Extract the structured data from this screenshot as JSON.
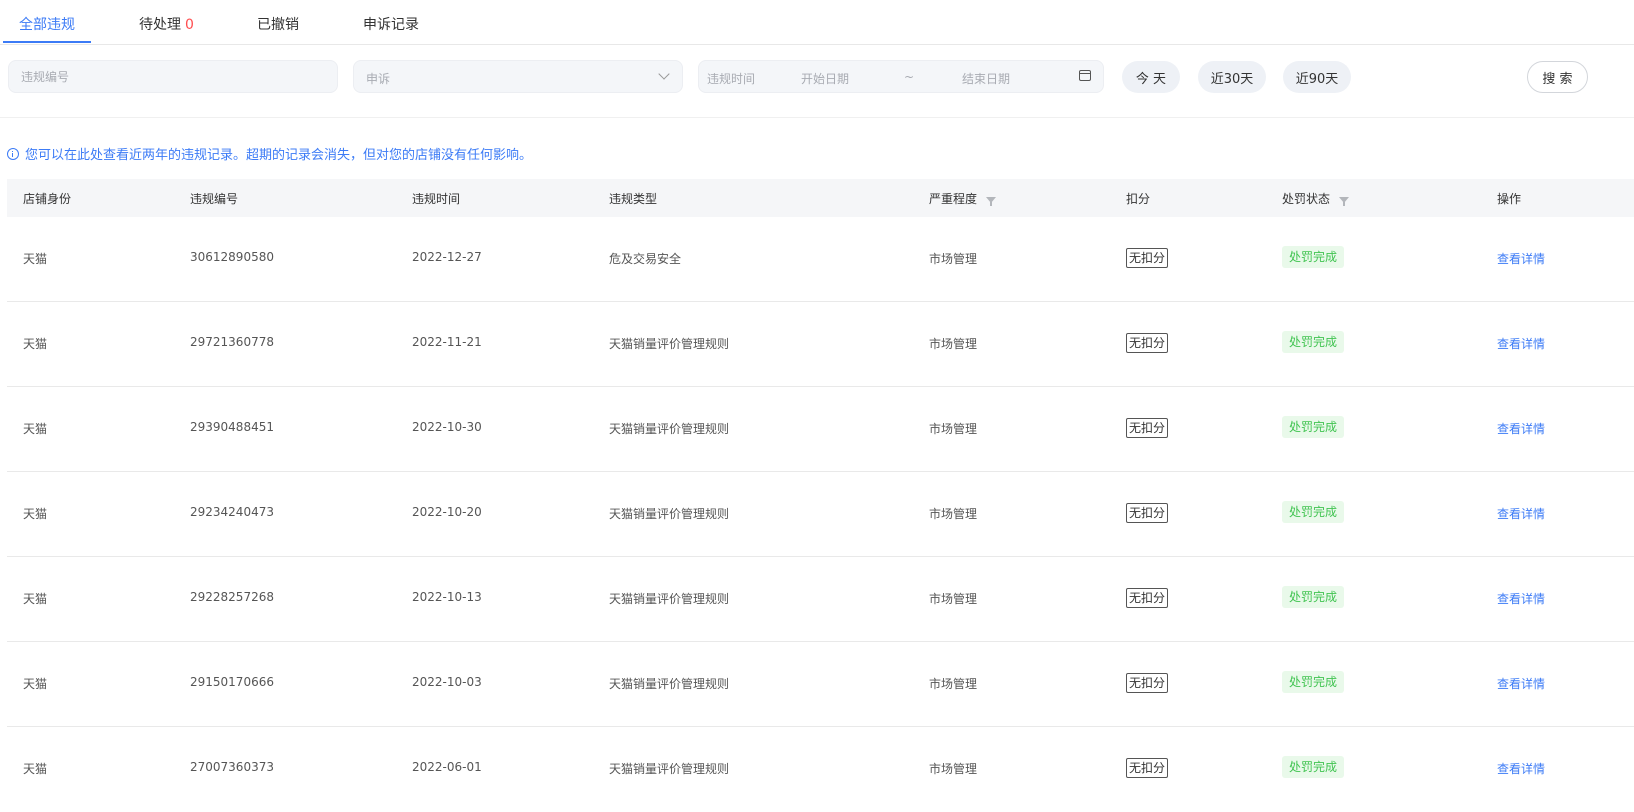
{
  "tabs": [
    {
      "label": "全部违规"
    },
    {
      "label": "待处理",
      "count": "0"
    },
    {
      "label": "已撤销"
    },
    {
      "label": "申诉记录"
    }
  ],
  "filters": {
    "violation_no_placeholder": "违规编号",
    "appeal_select_value": "申诉",
    "date_label": "违规时间",
    "start_placeholder": "开始日期",
    "range_sep": "~",
    "end_placeholder": "结束日期",
    "quick": [
      "今 天",
      "近30天",
      "近90天"
    ],
    "search_label": "搜 索"
  },
  "notice": "您可以在此处查看近两年的违规记录。超期的记录会消失，但对您的店铺没有任何影响。",
  "table": {
    "headers": [
      "店铺身份",
      "违规编号",
      "违规时间",
      "违规类型",
      "严重程度",
      "扣分",
      "处罚状态",
      "操作"
    ],
    "rows": [
      {
        "shop": "天猫",
        "id": "30612890580",
        "date": "2022-12-27",
        "type": "危及交易安全",
        "severity": "市场管理",
        "score": "无扣分",
        "status": "处罚完成",
        "action": "查看详情"
      },
      {
        "shop": "天猫",
        "id": "29721360778",
        "date": "2022-11-21",
        "type": "天猫销量评价管理规则",
        "severity": "市场管理",
        "score": "无扣分",
        "status": "处罚完成",
        "action": "查看详情"
      },
      {
        "shop": "天猫",
        "id": "29390488451",
        "date": "2022-10-30",
        "type": "天猫销量评价管理规则",
        "severity": "市场管理",
        "score": "无扣分",
        "status": "处罚完成",
        "action": "查看详情"
      },
      {
        "shop": "天猫",
        "id": "29234240473",
        "date": "2022-10-20",
        "type": "天猫销量评价管理规则",
        "severity": "市场管理",
        "score": "无扣分",
        "status": "处罚完成",
        "action": "查看详情"
      },
      {
        "shop": "天猫",
        "id": "29228257268",
        "date": "2022-10-13",
        "type": "天猫销量评价管理规则",
        "severity": "市场管理",
        "score": "无扣分",
        "status": "处罚完成",
        "action": "查看详情"
      },
      {
        "shop": "天猫",
        "id": "29150170666",
        "date": "2022-10-03",
        "type": "天猫销量评价管理规则",
        "severity": "市场管理",
        "score": "无扣分",
        "status": "处罚完成",
        "action": "查看详情"
      },
      {
        "shop": "天猫",
        "id": "27007360373",
        "date": "2022-06-01",
        "type": "天猫销量评价管理规则",
        "severity": "市场管理",
        "score": "无扣分",
        "status": "处罚完成",
        "action": "查看详情"
      }
    ]
  },
  "colors": {
    "accent": "#3c7bf6",
    "pending_count": "#ff4d4f",
    "status_green": "#41c451"
  }
}
